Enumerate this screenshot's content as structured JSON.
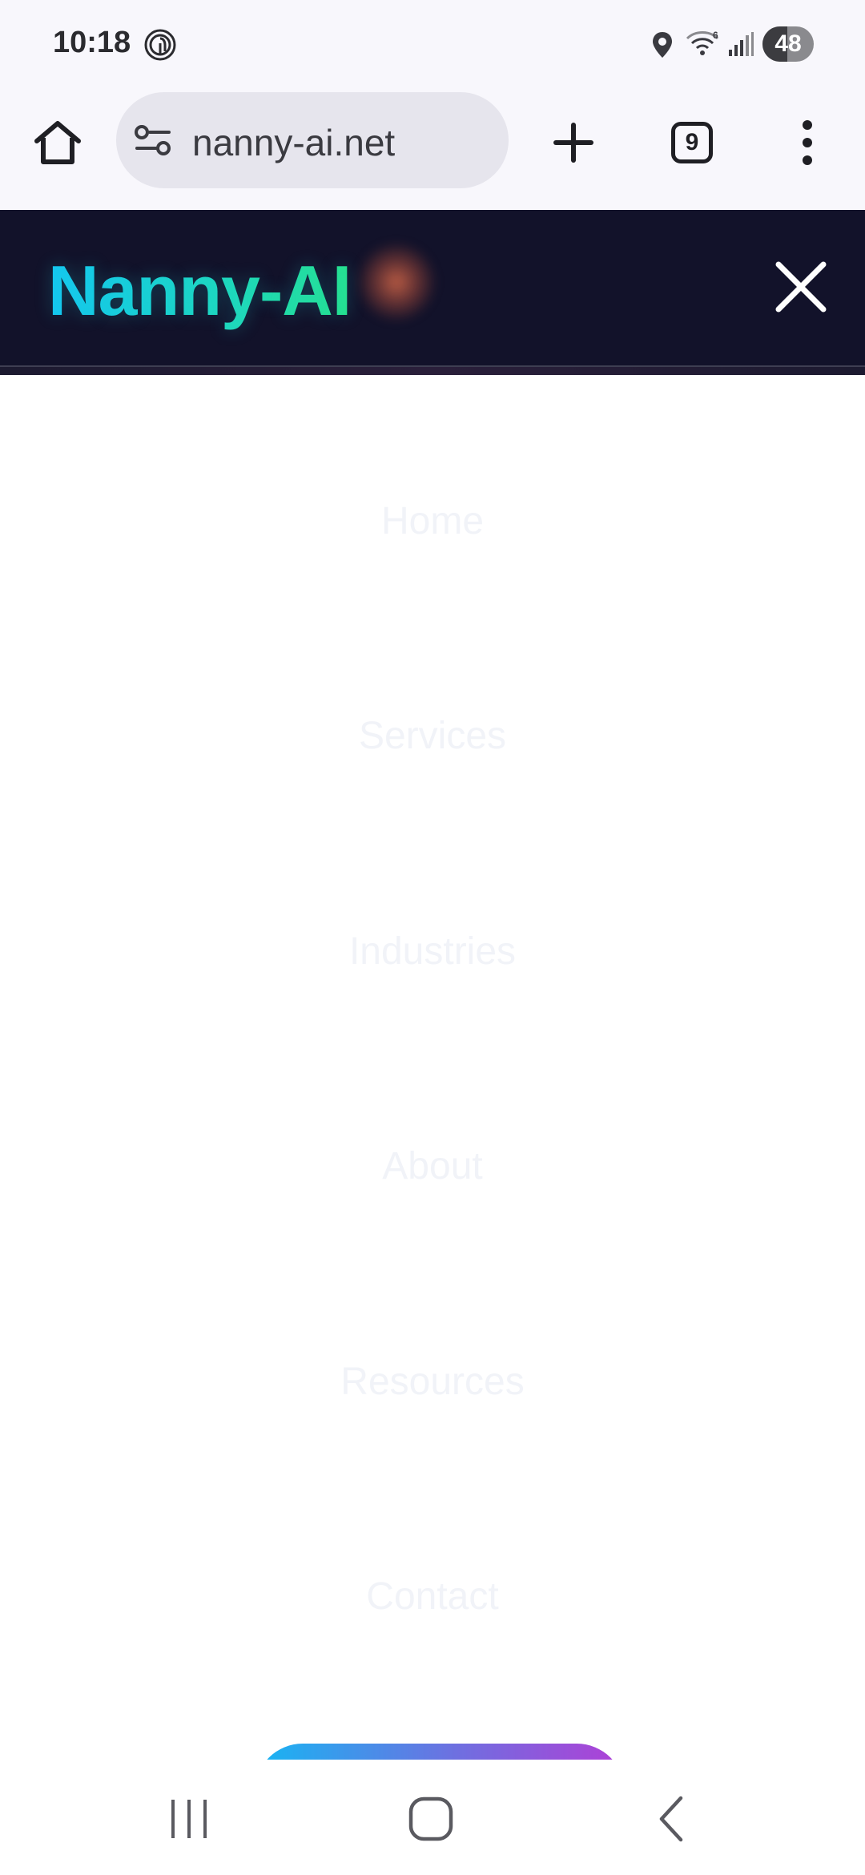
{
  "status_bar": {
    "time": "10:18",
    "left_icons": [
      "fingerprint-icon"
    ],
    "right_icons": [
      "location-icon",
      "wifi-icon",
      "signal-icon"
    ],
    "wifi_label": "6",
    "battery_percent": "48",
    "battery_level": 0.48
  },
  "browser": {
    "url": "nanny-ai.net",
    "tab_count": "9",
    "icons": [
      "home-icon",
      "tune-icon",
      "plus-icon",
      "tabs-icon",
      "more-vert-icon"
    ]
  },
  "site_header": {
    "logo": "Nanny-AI",
    "close_icon": "close-icon",
    "colors": {
      "header_bg": "#12122a",
      "logo_gradient_start": "#13c6f2",
      "logo_gradient_end": "#27e28a",
      "glow": "#d66848"
    }
  },
  "menu": {
    "items": [
      {
        "label": "Home"
      },
      {
        "label": "Services"
      },
      {
        "label": "Industries"
      },
      {
        "label": "About"
      },
      {
        "label": "Resources"
      },
      {
        "label": "Contact"
      }
    ],
    "item_color": "#f1f3f8",
    "cta_gradient": [
      "#16b6f3",
      "#6f6fe0",
      "#b03fd6"
    ]
  },
  "nav_bar": {
    "icons": [
      "recents-icon",
      "home-circle-icon",
      "back-icon"
    ]
  }
}
